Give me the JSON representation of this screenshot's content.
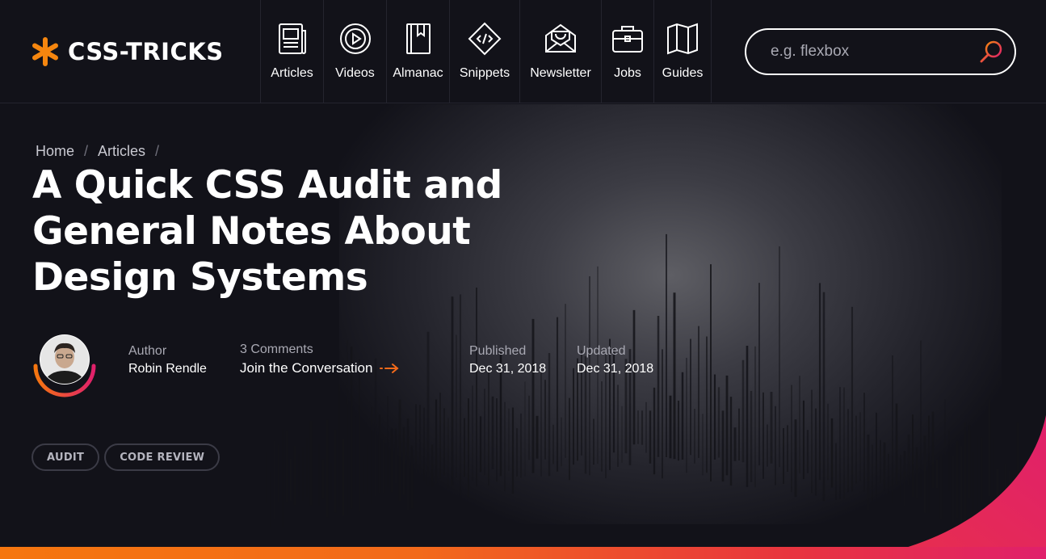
{
  "header": {
    "logo_text": "CSS-TRICKS",
    "nav": [
      {
        "label": "Articles",
        "icon": "newspaper-icon"
      },
      {
        "label": "Videos",
        "icon": "play-circle-icon"
      },
      {
        "label": "Almanac",
        "icon": "bookmark-book-icon"
      },
      {
        "label": "Snippets",
        "icon": "code-diamond-icon"
      },
      {
        "label": "Newsletter",
        "icon": "envelope-icon"
      },
      {
        "label": "Jobs",
        "icon": "briefcase-icon"
      },
      {
        "label": "Guides",
        "icon": "map-icon"
      }
    ],
    "search": {
      "placeholder": "e.g. flexbox",
      "icon": "search-icon"
    }
  },
  "breadcrumb": {
    "home": "Home",
    "articles": "Articles",
    "separator": "/"
  },
  "article": {
    "title": "A Quick CSS Audit and General Notes About Design Systems",
    "author_label": "Author",
    "author_name": "Robin Rendle",
    "comments_count": "3 Comments",
    "comments_cta": "Join the Conversation",
    "published_label": "Published",
    "published_date": "Dec 31, 2018",
    "updated_label": "Updated",
    "updated_date": "Dec 31, 2018"
  },
  "tags": [
    "AUDIT",
    "CODE REVIEW"
  ],
  "colors": {
    "accent_orange": "#f5760f",
    "accent_pink": "#e0206b",
    "background": "#121219"
  }
}
